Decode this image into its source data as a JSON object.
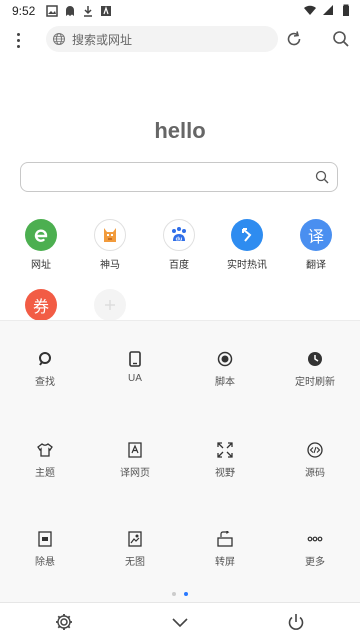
{
  "status": {
    "time": "9:52"
  },
  "toolbar": {
    "search_placeholder": "搜索或网址"
  },
  "home": {
    "title": "hello"
  },
  "shortcuts": [
    {
      "label": "网址",
      "icon": "e-browser-icon",
      "color": "#4caf50",
      "glyph": "e"
    },
    {
      "label": "神马",
      "icon": "shenma-icon",
      "color": "#ffffff",
      "glyph": ""
    },
    {
      "label": "百度",
      "icon": "baidu-paw-icon",
      "color": "#ffffff",
      "glyph": "du"
    },
    {
      "label": "实时热讯",
      "icon": "trend-arrow-icon",
      "color": "#2e8cf0",
      "glyph": "↖"
    },
    {
      "label": "翻译",
      "icon": "translate-icon",
      "color": "#4a8ff0",
      "glyph": "译"
    },
    {
      "label": "",
      "icon": "coupon-icon",
      "color": "#f25c45",
      "glyph": "券"
    },
    {
      "label": "",
      "icon": "add-shortcut-icon",
      "color": "#f4f4f4",
      "glyph": "+"
    }
  ],
  "tools": [
    {
      "label": "查找",
      "icon": "find-icon"
    },
    {
      "label": "UA",
      "icon": "tablet-icon"
    },
    {
      "label": "脚本",
      "icon": "script-radio-icon"
    },
    {
      "label": "定时刷新",
      "icon": "clock-icon"
    },
    {
      "label": "主题",
      "icon": "shirt-icon"
    },
    {
      "label": "译网页",
      "icon": "translate-page-icon"
    },
    {
      "label": "视野",
      "icon": "expand-icon"
    },
    {
      "label": "源码",
      "icon": "source-code-icon"
    },
    {
      "label": "除悬",
      "icon": "remove-float-icon"
    },
    {
      "label": "无图",
      "icon": "no-image-icon"
    },
    {
      "label": "转屏",
      "icon": "rotate-screen-icon"
    },
    {
      "label": "更多",
      "icon": "more-icon"
    }
  ],
  "page_indicator": {
    "pages": 2,
    "active": 2
  }
}
